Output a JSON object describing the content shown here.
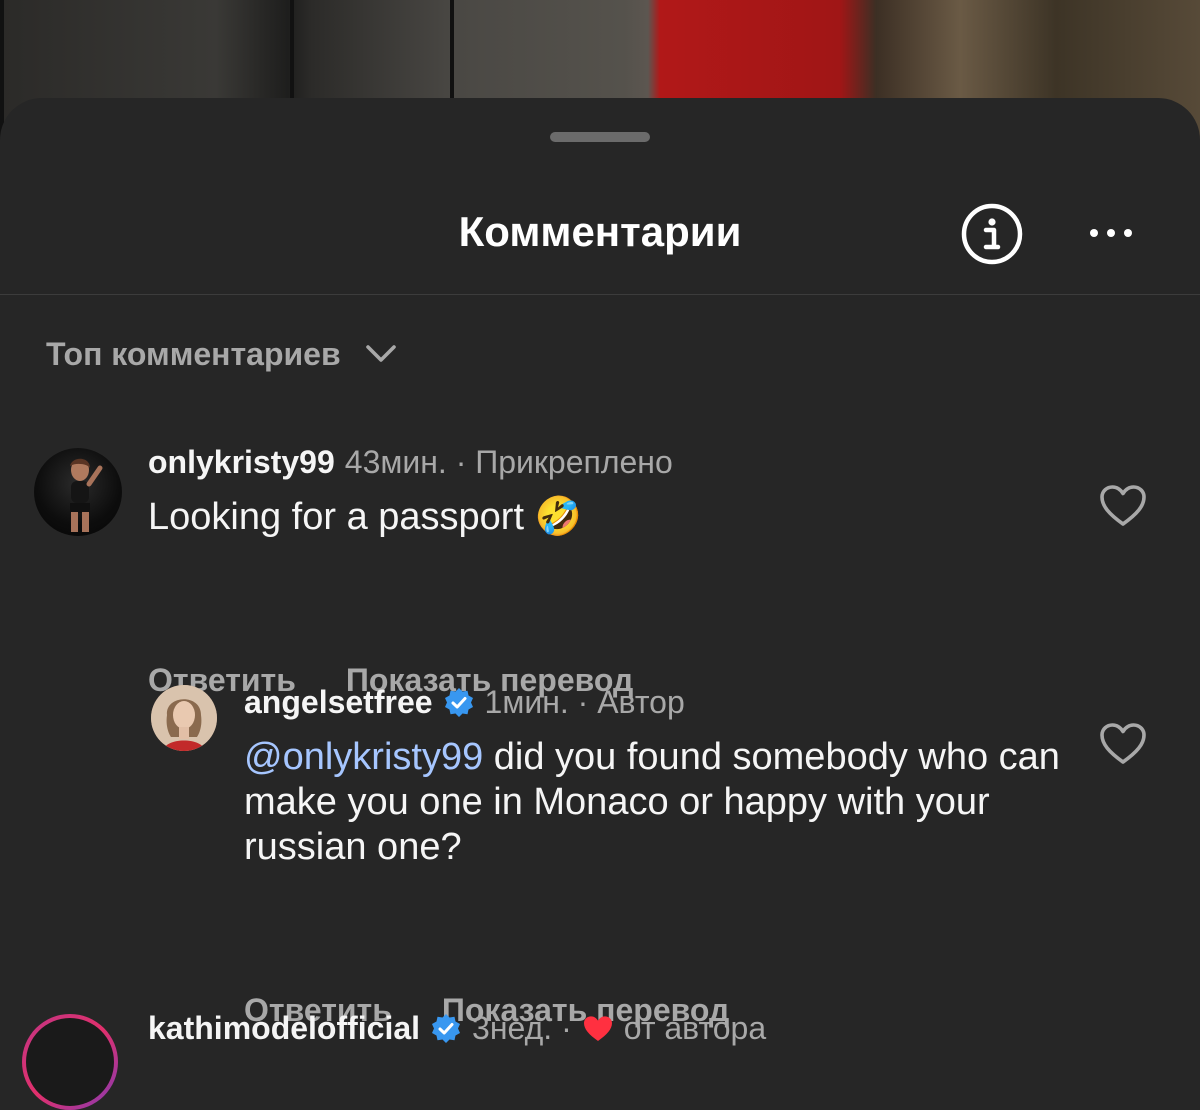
{
  "header": {
    "title": "Комментарии",
    "info_icon": "info-circle-icon",
    "more_icon": "ellipsis-icon"
  },
  "sort": {
    "label": "Топ комментариев",
    "icon": "chevron-down-icon"
  },
  "comments": [
    {
      "username": "onlykristy99",
      "meta": "43мин. · Прикреплено",
      "text": "Looking for a passport 🤣",
      "reply_label": "Ответить",
      "translate_label": "Показать перевод"
    },
    {
      "username": "angelsetfree",
      "verified": true,
      "meta": "1мин. · Автор",
      "mention": "@onlykristy99",
      "text": " did you found somebody who can make you one in Monaco or happy with your russian one?",
      "reply_label": "Ответить",
      "translate_label": "Показать перевод"
    },
    {
      "username": "kathimodelofficial",
      "verified": true,
      "meta_time": "3нед. ·",
      "meta_author": "от автора"
    }
  ],
  "colors": {
    "background": "#262626",
    "text_primary": "#f5f5f5",
    "text_secondary": "#a8a8a8",
    "mention": "#a6c6ff",
    "verified": "#3897f0",
    "heart_red": "#ff3040"
  }
}
